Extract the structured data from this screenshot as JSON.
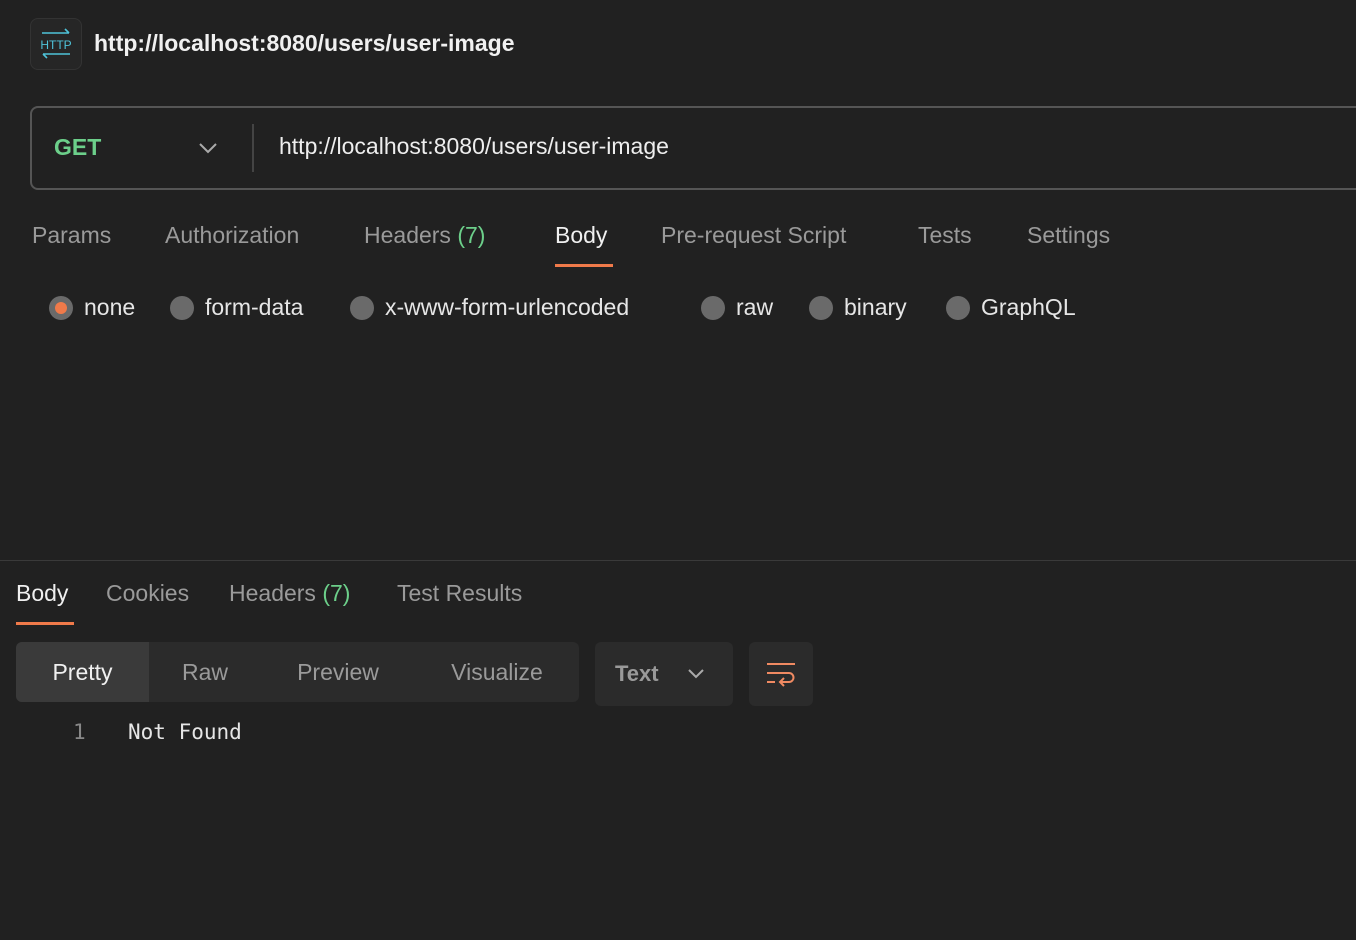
{
  "header": {
    "title": "http://localhost:8080/users/user-image",
    "icon": "http-icon",
    "icon_text": "HTTP"
  },
  "request": {
    "method": "GET",
    "url": "http://localhost:8080/users/user-image"
  },
  "request_tabs": [
    {
      "label": "Params"
    },
    {
      "label": "Authorization"
    },
    {
      "label": "Headers",
      "count": "(7)"
    },
    {
      "label": "Body",
      "active": true
    },
    {
      "label": "Pre-request Script"
    },
    {
      "label": "Tests"
    },
    {
      "label": "Settings"
    }
  ],
  "body_types": [
    {
      "label": "none",
      "selected": true
    },
    {
      "label": "form-data"
    },
    {
      "label": "x-www-form-urlencoded"
    },
    {
      "label": "raw"
    },
    {
      "label": "binary"
    },
    {
      "label": "GraphQL"
    }
  ],
  "response_tabs": [
    {
      "label": "Body",
      "active": true
    },
    {
      "label": "Cookies"
    },
    {
      "label": "Headers",
      "count": "(7)"
    },
    {
      "label": "Test Results"
    }
  ],
  "view_modes": [
    {
      "label": "Pretty",
      "active": true
    },
    {
      "label": "Raw"
    },
    {
      "label": "Preview"
    },
    {
      "label": "Visualize"
    }
  ],
  "format": "Text",
  "response_lines": [
    {
      "num": "1",
      "text": "Not Found"
    }
  ],
  "colors": {
    "accent": "#f07a4a",
    "method_get": "#6ccf8a",
    "http_icon": "#4fc3d9"
  }
}
